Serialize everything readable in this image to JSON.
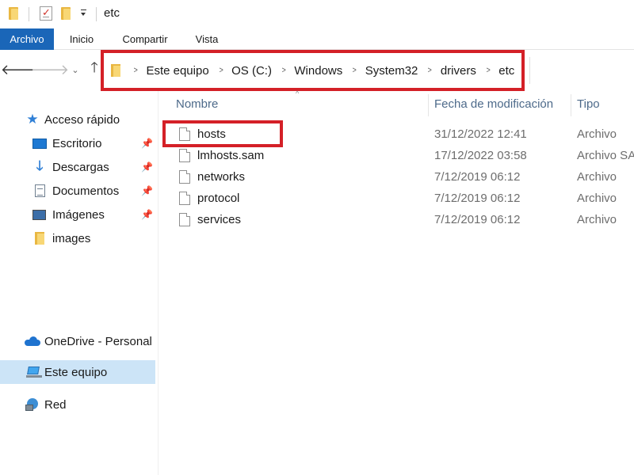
{
  "window": {
    "title": "etc"
  },
  "ribbon": {
    "tabs": [
      {
        "label": "Archivo"
      },
      {
        "label": "Inicio"
      },
      {
        "label": "Compartir"
      },
      {
        "label": "Vista"
      }
    ]
  },
  "address": {
    "segments": [
      "Este equipo",
      "OS (C:)",
      "Windows",
      "System32",
      "drivers",
      "etc"
    ]
  },
  "sidebar": {
    "quick_access": {
      "label": "Acceso rápido",
      "icon": "star-icon"
    },
    "pinned": [
      {
        "label": "Escritorio",
        "icon": "desktop-icon",
        "pinned": true
      },
      {
        "label": "Descargas",
        "icon": "download-icon",
        "pinned": true
      },
      {
        "label": "Documentos",
        "icon": "documents-icon",
        "pinned": true
      },
      {
        "label": "Imágenes",
        "icon": "pictures-icon",
        "pinned": true
      },
      {
        "label": "images",
        "icon": "folder-icon",
        "pinned": false
      }
    ],
    "onedrive": {
      "label": "OneDrive - Personal",
      "icon": "onedrive-icon"
    },
    "this_pc": {
      "label": "Este equipo",
      "icon": "this-pc-icon",
      "selected": true
    },
    "network": {
      "label": "Red",
      "icon": "network-icon"
    }
  },
  "columns": {
    "name": "Nombre",
    "modified": "Fecha de modificación",
    "type": "Tipo"
  },
  "files": [
    {
      "name": "hosts",
      "modified": "31/12/2022 12:41",
      "type": "Archivo",
      "highlighted": true
    },
    {
      "name": "lmhosts.sam",
      "modified": "17/12/2022 03:58",
      "type": "Archivo SA"
    },
    {
      "name": "networks",
      "modified": "7/12/2019 06:12",
      "type": "Archivo"
    },
    {
      "name": "protocol",
      "modified": "7/12/2019 06:12",
      "type": "Archivo"
    },
    {
      "name": "services",
      "modified": "7/12/2019 06:12",
      "type": "Archivo"
    }
  ],
  "colors": {
    "file_tab": "#1a66b8",
    "highlight_box": "#d42027",
    "selected_item": "#cce4f7",
    "column_header": "#4d6a8a"
  }
}
